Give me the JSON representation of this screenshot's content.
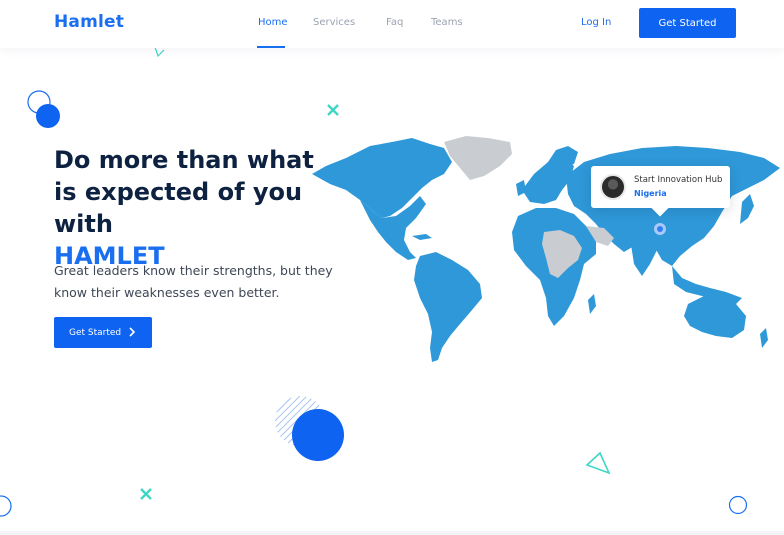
{
  "navbar": {
    "logo": "Hamlet",
    "links": [
      {
        "label": "Home",
        "active": true
      },
      {
        "label": "Services",
        "active": false
      },
      {
        "label": "Faq",
        "active": false
      },
      {
        "label": "Teams",
        "active": false
      }
    ],
    "login": "Log In",
    "cta": "Get Started"
  },
  "hero": {
    "title_line": "Do more than what is expected of you with",
    "title_brand": "HAMLET",
    "subtitle": "Great leaders know their strengths, but they know their weaknesses even better.",
    "cta": "Get Started"
  },
  "map_tooltip": {
    "title": "Start Innovation Hub",
    "location": "Nigeria"
  },
  "colors": {
    "accent": "#1a6ff0",
    "map_blue": "#2f98d8",
    "map_gray": "#c9cdd2",
    "teal": "#3fd6c5"
  }
}
